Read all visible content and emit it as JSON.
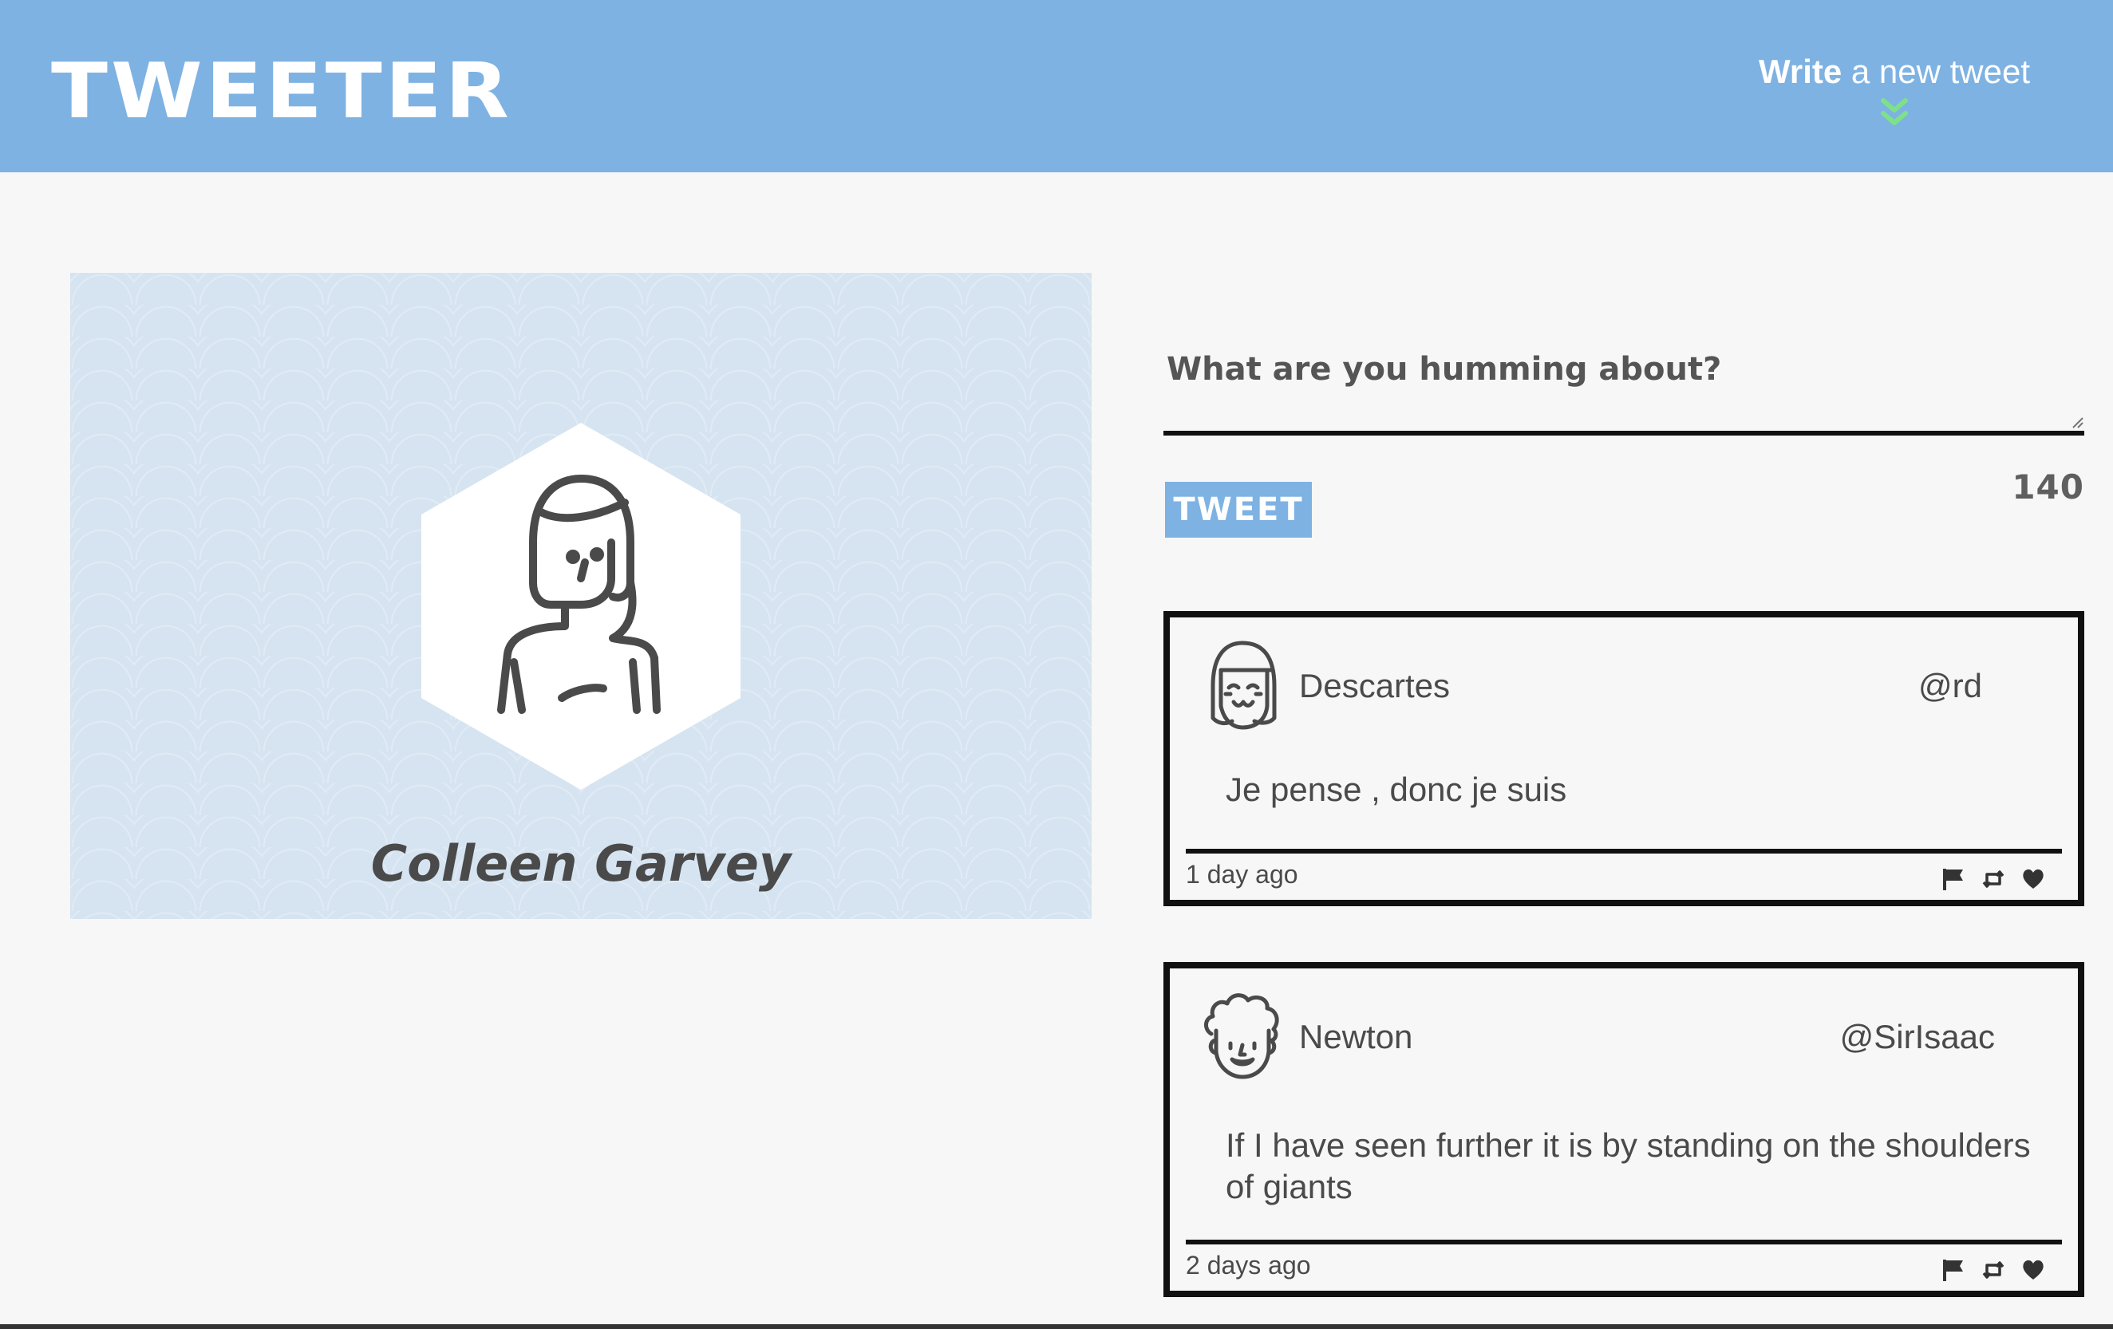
{
  "header": {
    "logo": "TWEETER",
    "compose_bold": "Write",
    "compose_rest": " a new tweet",
    "compose_icon": "double-chevron-down-icon",
    "brand_color": "#7eb2e3",
    "chevron_color": "#7fe08a"
  },
  "profile": {
    "name": "Colleen Garvey",
    "avatar_icon": "woman-avatar-icon"
  },
  "composer": {
    "placeholder": "What are you humming about?",
    "value": "",
    "button_label": "TWEET",
    "counter": "140"
  },
  "tweets": [
    {
      "author": "Descartes",
      "handle": "@rd",
      "avatar_icon": "girl-avatar-icon",
      "text": "Je pense , donc je suis",
      "time": "1 day ago",
      "actions": [
        "flag-icon",
        "retweet-icon",
        "heart-icon"
      ]
    },
    {
      "author": "Newton",
      "handle": "@SirIsaac",
      "avatar_icon": "curly-hair-avatar-icon",
      "text": "If I have seen further it is by standing on the shoulders of giants",
      "time": "2 days ago",
      "actions": [
        "flag-icon",
        "retweet-icon",
        "heart-icon"
      ]
    }
  ]
}
